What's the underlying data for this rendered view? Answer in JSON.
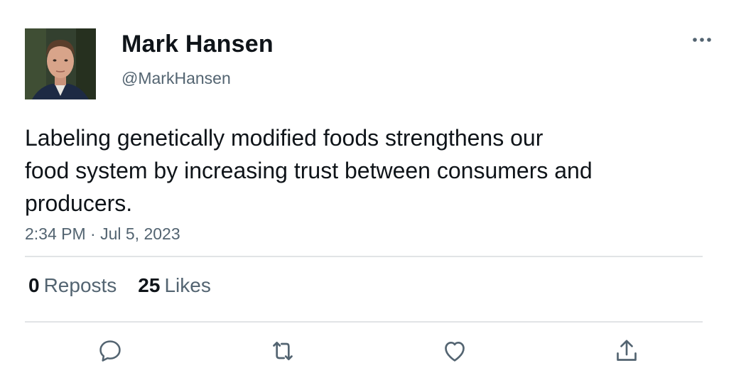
{
  "author": {
    "display_name": "Mark Hansen",
    "handle": "@MarkHansen"
  },
  "tweet": {
    "text_lines": [
      "Labeling genetically modified foods strengthens our",
      "food system by increasing trust between consumers and",
      "producers."
    ],
    "timestamp": "2:34 PM · Jul 5, 2023"
  },
  "stats": {
    "reposts_count": "0",
    "reposts_label": "Reposts",
    "likes_count": "25",
    "likes_label": "Likes"
  },
  "actions": {
    "icons": [
      "reply-icon",
      "repost-icon",
      "like-icon",
      "share-icon"
    ]
  },
  "colors": {
    "text_primary": "#0f1419",
    "text_secondary": "#536471",
    "divider": "#e1e4e6"
  }
}
